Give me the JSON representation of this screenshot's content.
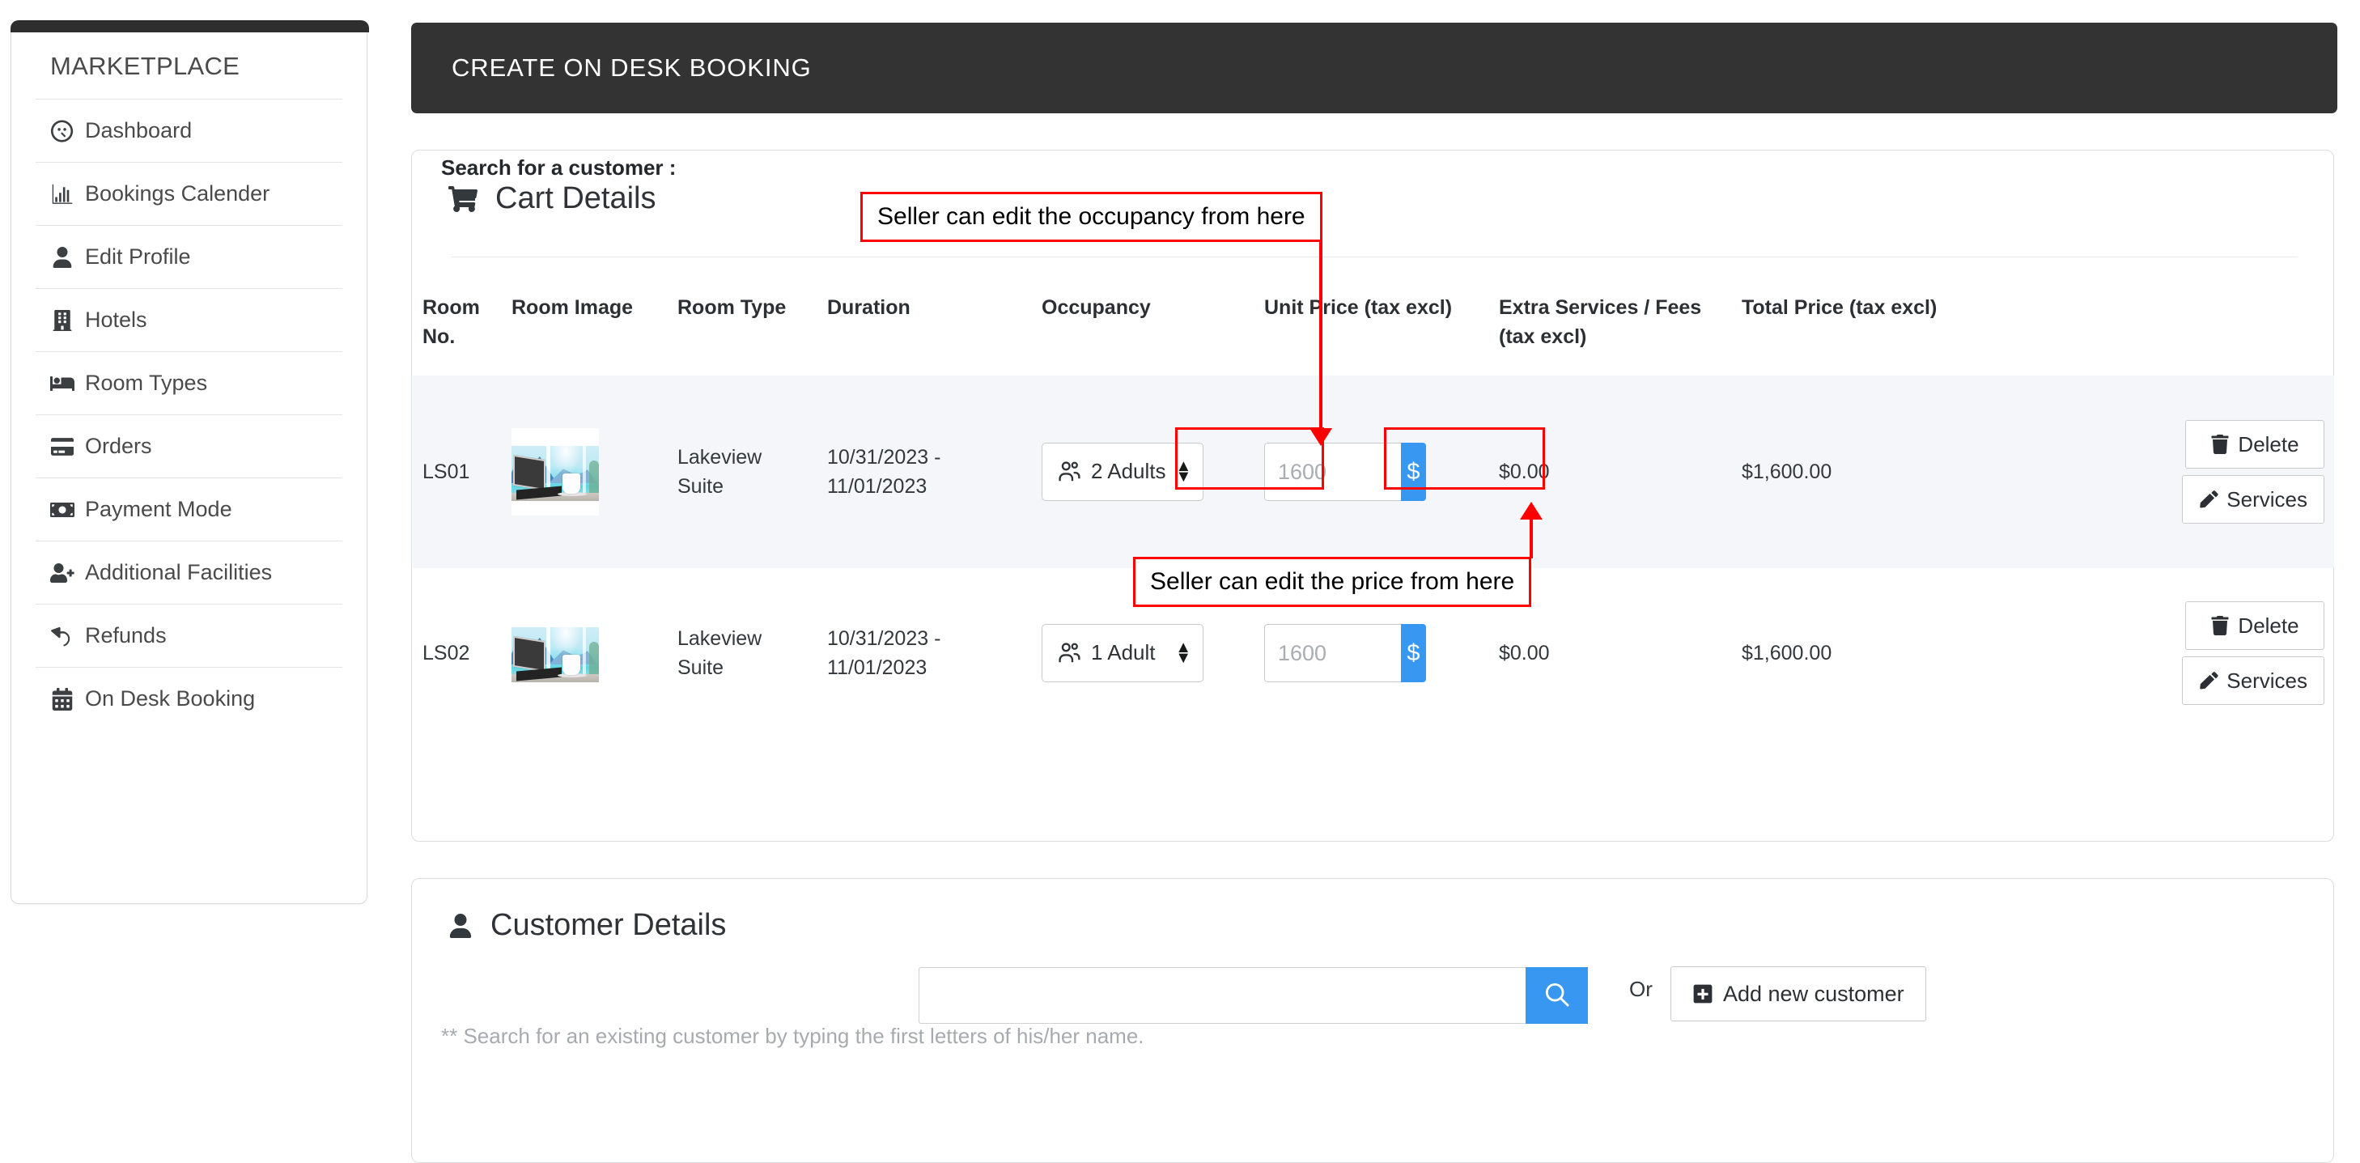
{
  "sidebar": {
    "title": "MARKETPLACE",
    "items": [
      {
        "label": "Dashboard",
        "icon": "dashboard-icon"
      },
      {
        "label": "Bookings Calender",
        "icon": "bar-chart-icon"
      },
      {
        "label": "Edit Profile",
        "icon": "user-icon"
      },
      {
        "label": "Hotels",
        "icon": "building-icon"
      },
      {
        "label": "Room Types",
        "icon": "bed-icon"
      },
      {
        "label": "Orders",
        "icon": "credit-card-icon"
      },
      {
        "label": "Payment Mode",
        "icon": "money-bill-icon"
      },
      {
        "label": "Additional Facilities",
        "icon": "user-plus-icon"
      },
      {
        "label": "Refunds",
        "icon": "undo-icon"
      },
      {
        "label": "On Desk Booking",
        "icon": "calendar-icon"
      }
    ]
  },
  "header": {
    "title": "CREATE ON DESK BOOKING",
    "bg_color": "#333333"
  },
  "cart": {
    "title": "Cart Details",
    "icon": "shopping-cart-icon",
    "columns": [
      "Room No.",
      "Room Image",
      "Room Type",
      "Duration",
      "Occupancy",
      "Unit Price (tax excl)",
      "Extra Services / Fees (tax excl)",
      "Total Price (tax excl)",
      ""
    ],
    "rows": [
      {
        "room_no": "LS01",
        "room_image_alt": "lakeview-room-photo",
        "room_type": "Lakeview Suite",
        "duration": "10/31/2023 - 11/01/2023",
        "occupancy": "2 Adults",
        "unit_price_placeholder": "1600",
        "unit_price_value": "",
        "currency_symbol": "$",
        "extra_services": "$0.00",
        "total_price": "$1,600.00",
        "delete_label": "Delete",
        "services_label": "Services",
        "highlighted": true
      },
      {
        "room_no": "LS02",
        "room_image_alt": "lakeview-room-photo",
        "room_type": "Lakeview Suite",
        "duration": "10/31/2023 - 11/01/2023",
        "occupancy": "1 Adult",
        "unit_price_placeholder": "1600",
        "unit_price_value": "",
        "currency_symbol": "$",
        "extra_services": "$0.00",
        "total_price": "$1,600.00",
        "delete_label": "Delete",
        "services_label": "Services",
        "highlighted": false
      }
    ]
  },
  "annotations": {
    "occupancy_note": "Seller can edit the occupancy from here",
    "price_note": "Seller can edit the price from here",
    "color": "#ff0000"
  },
  "customer": {
    "title": "Customer Details",
    "icon": "user-icon",
    "search_label": "Search for a customer :",
    "search_placeholder": "",
    "search_value": "",
    "search_button_icon": "search-icon",
    "or_text": "Or",
    "add_new_label": "Add new customer",
    "add_new_icon": "plus-square-icon",
    "hint": "** Search for an existing customer by typing the first letters of his/her name."
  },
  "theme": {
    "accent_blue": "#3897f0",
    "dark": "#333333",
    "row_highlight": "#f4f6f9"
  }
}
